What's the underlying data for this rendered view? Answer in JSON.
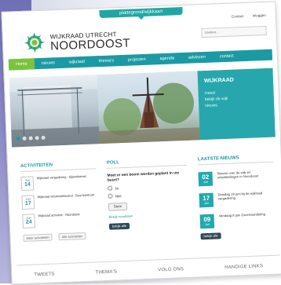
{
  "site": {
    "ribbon_label": "plattegrond/wijkkaart",
    "top_links": [
      "Contact",
      "Inloggen"
    ],
    "logo_line1": "WIJKRAAD UTRECHT",
    "logo_line2": "NOORDOOST",
    "search_placeholder": "zoeken..."
  },
  "nav": {
    "items": [
      "Home",
      "nieuws",
      "wijkraad",
      "thema's",
      "projecten",
      "agenda",
      "adviezen",
      "contact"
    ]
  },
  "hero": {
    "title": "WIJKRAAD",
    "lines": [
      "meest",
      "bekijk de wijk",
      "nieuws"
    ]
  },
  "activiteiten": {
    "title": "ACTIVITEITEN",
    "items": [
      {
        "month": "Jun",
        "day": "14",
        "text": "Wijkraad vergadering - Bijeenkomst"
      },
      {
        "month": "Jun",
        "day": "17",
        "text": "Wijkraad informatieavond - Buurtcentrum"
      },
      {
        "month": "Jun",
        "day": "24",
        "text": "Wijkraad activiteit - Noordoost"
      }
    ],
    "links": [
      "Meer activiteiten",
      "Alle activiteiten"
    ]
  },
  "poll": {
    "title": "POLL",
    "question": "Moet er een boom worden geplant in uw buurt?",
    "options": [
      "Ja",
      "Nee"
    ],
    "vote_label": "Stem",
    "results_link": "Bekijk resultaten",
    "button_label": "bekijk alle"
  },
  "nieuws": {
    "title": "LAATSTE NIEUWS",
    "items": [
      {
        "day": "02",
        "month": "Jun",
        "text": "Nieuws over de wijk en ontwikkelingen in Noordoost"
      },
      {
        "day": "17",
        "month": "Jun",
        "text": "Dinsdag 19 juni bij de wijkraad vergadering"
      },
      {
        "day": "09",
        "month": "Jun",
        "text": "Vandaag 8 juni Groenwandeling"
      }
    ],
    "button_label": "bekijk alle"
  },
  "footer": {
    "items": [
      "TWEETS",
      "THEMA'S",
      "VOLG ONS",
      "HANDIGE LINKS"
    ]
  },
  "colors": {
    "teal": "#1b9aa4",
    "green": "#79c43b",
    "nav_bg": "#1b9aa4"
  }
}
